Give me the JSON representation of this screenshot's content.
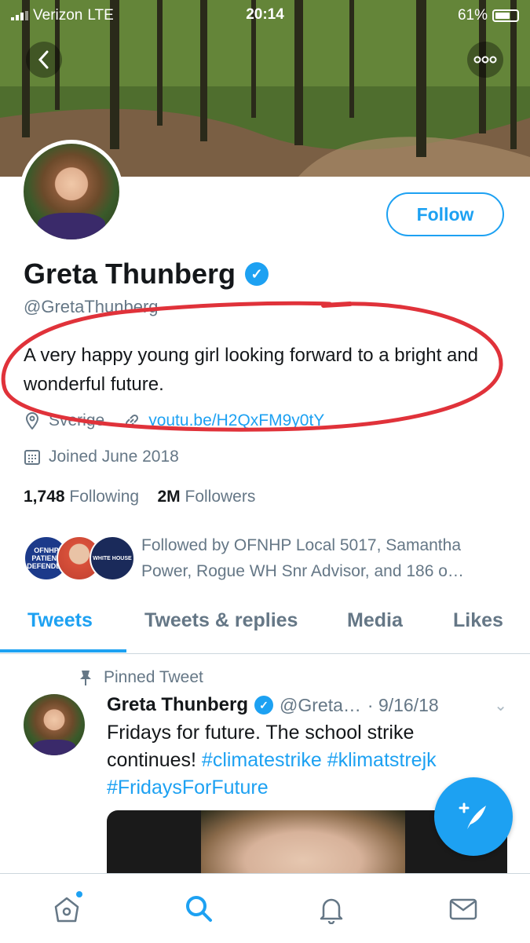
{
  "status_bar": {
    "carrier": "Verizon",
    "network": "LTE",
    "time": "20:14",
    "battery": "61%"
  },
  "profile": {
    "name": "Greta Thunberg",
    "handle": "@GretaThunberg",
    "follow_label": "Follow",
    "bio": "A very happy young girl looking forward to a bright and wonderful future.",
    "location": "Sverige",
    "link": "youtu.be/H2QxFM9y0tY",
    "joined": "Joined June 2018",
    "following_count": "1,748",
    "following_label": "Following",
    "followers_count": "2M",
    "followers_label": "Followers",
    "followed_by": "Followed by OFNHP Local 5017, Samantha Power, Rogue WH Snr Advisor, and 186 o…",
    "followed_avatar_1_text": "OFNHP PATIENT DEFENDER",
    "followed_avatar_3_text": "WHITE HOUSE"
  },
  "tabs": [
    "Tweets",
    "Tweets & replies",
    "Media",
    "Likes"
  ],
  "tweet": {
    "pinned_label": "Pinned Tweet",
    "name": "Greta Thunberg",
    "handle": "@Greta…",
    "date": "· 9/16/18",
    "text_plain": "Fridays for future. The school strike continues! ",
    "tag1": "#climatestrike",
    "tag2": "#klimatstrejk",
    "tag3": "#FridaysForFuture"
  },
  "colors": {
    "accent": "#1da1f2",
    "secondary_text": "#657786",
    "annotation_circle": "#e0323a"
  },
  "icons": [
    "back-icon",
    "more-icon",
    "verified-icon",
    "location-icon",
    "link-icon",
    "calendar-icon",
    "pin-icon",
    "compose-icon",
    "home-icon",
    "search-icon",
    "notifications-icon",
    "messages-icon"
  ]
}
